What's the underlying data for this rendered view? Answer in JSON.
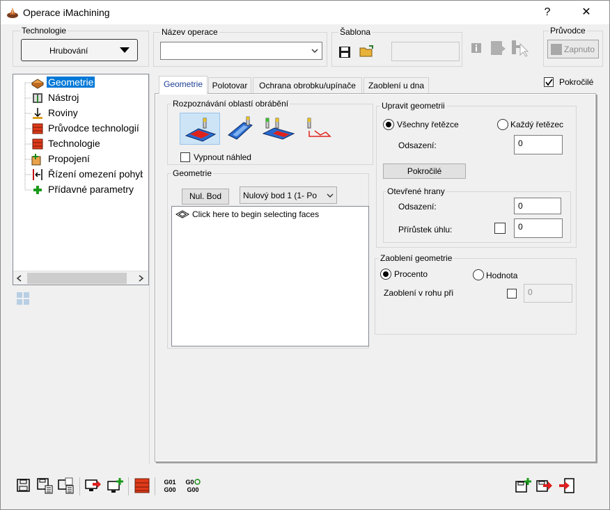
{
  "window": {
    "title": "Operace iMachining",
    "help": "?",
    "close": "✕"
  },
  "technologie": {
    "label": "Technologie",
    "value": "Hrubování"
  },
  "operation_name": {
    "label": "Název operace",
    "value": ""
  },
  "template": {
    "label": "Šablona",
    "value": ""
  },
  "guide": {
    "label": "Průvodce",
    "button": "Zapnuto"
  },
  "tree": {
    "items": [
      {
        "label": "Geometrie"
      },
      {
        "label": "Nástroj"
      },
      {
        "label": "Roviny"
      },
      {
        "label": "Průvodce technologií"
      },
      {
        "label": "Technologie"
      },
      {
        "label": "Propojení"
      },
      {
        "label": "Řízení omezení pohybu"
      },
      {
        "label": "Přídavné parametry"
      }
    ]
  },
  "tabs": [
    {
      "label": "Geometrie"
    },
    {
      "label": "Polotovar"
    },
    {
      "label": "Ochrana obrobku/upínače"
    },
    {
      "label": "Zaoblení u dna"
    }
  ],
  "advanced": {
    "label": "Pokročilé",
    "checked": true
  },
  "recognition": {
    "label": "Rozpoznávání oblastí obrábění",
    "disable_preview": "Vypnout náhled"
  },
  "geometry": {
    "label": "Geometrie",
    "zero_button": "Nul. Bod",
    "zero_select": "Nulový bod 1 (1- Po",
    "list_hint": "Click here to begin selecting faces"
  },
  "edit_geometry": {
    "label": "Upravit geometrii",
    "all_chains": "Všechny řetězce",
    "each_chain": "Každý řetězec",
    "offset_label": "Odsazení:",
    "offset_value": "0",
    "advanced_button": "Pokročilé",
    "open_edges": {
      "label": "Otevřené hrany",
      "offset_label": "Odsazení:",
      "offset_value": "0",
      "angle_label": "Přírůstek úhlu:",
      "angle_value": "0"
    }
  },
  "fillet": {
    "label": "Zaoblení geometrie",
    "percent": "Procento",
    "value": "Hodnota",
    "corner_label": "Zaoblení v rohu při",
    "corner_value": "0"
  },
  "bottom": {
    "g1_top": "G01",
    "g1_bottom": "G00",
    "g2_top": "G0",
    "g2_bottom": "G00"
  }
}
